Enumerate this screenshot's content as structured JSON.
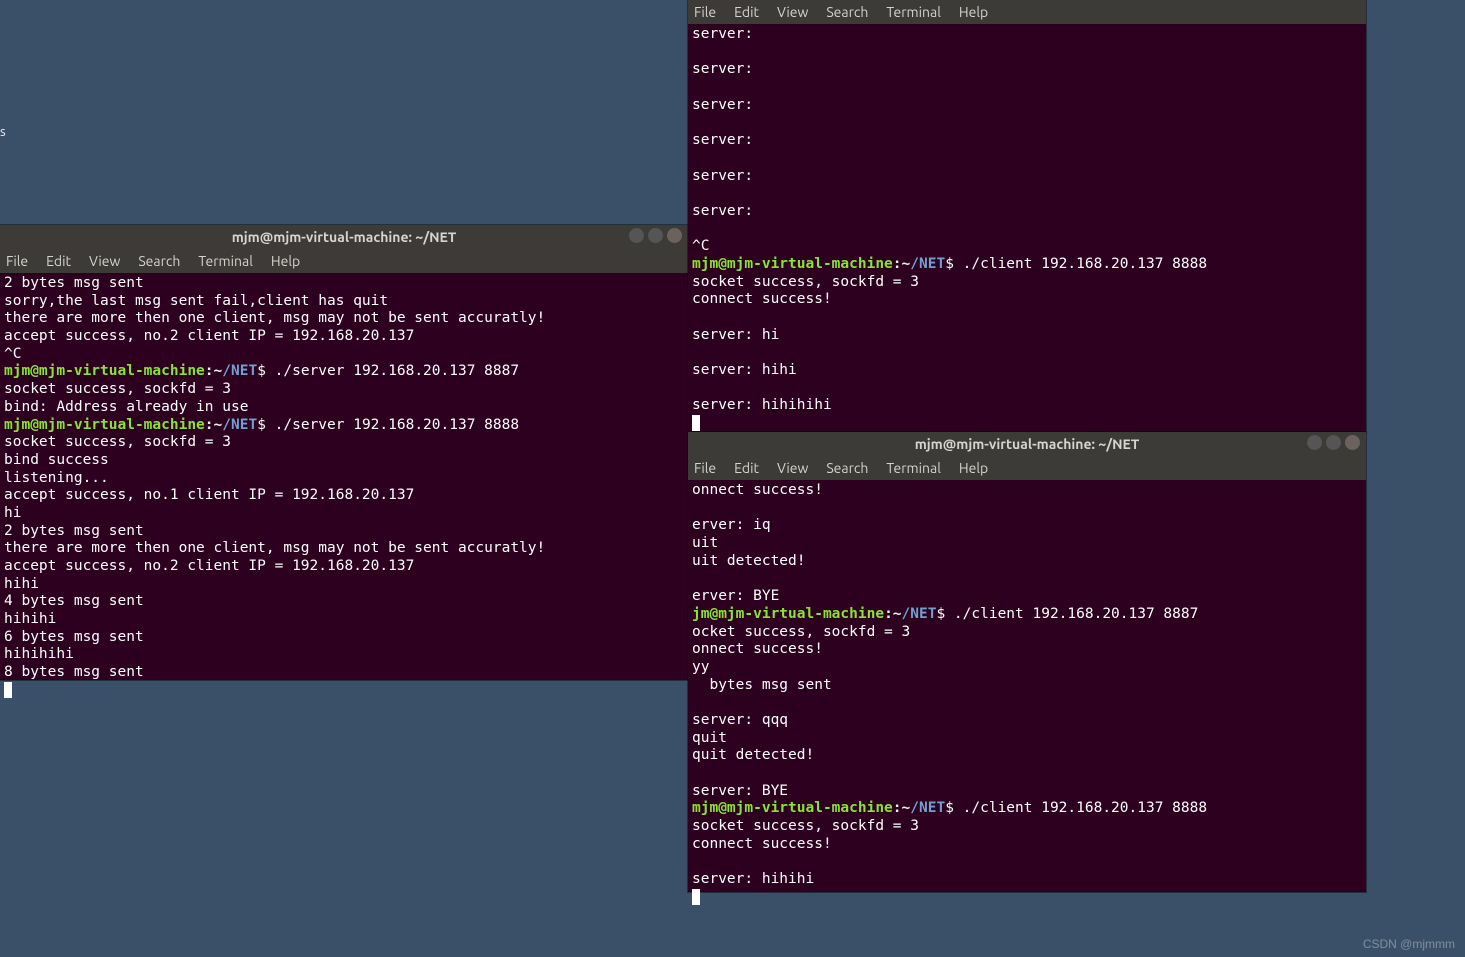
{
  "desktop_fragment": "s",
  "menus": {
    "file": "File",
    "edit": "Edit",
    "view": "View",
    "search": "Search",
    "terminal": "Terminal",
    "help": "Help"
  },
  "prompt": {
    "user_host": "mjm@mjm-virtual-machine",
    "colon": ":",
    "tilde": "~",
    "path": "/NET",
    "dollar": "$ "
  },
  "left": {
    "title": "mjm@mjm-virtual-machine: ~/NET",
    "pre_lines": [
      "2 bytes msg sent",
      "sorry,the last msg sent fail,client has quit",
      "there are more then one client, msg may not be sent accuratly!",
      "accept success, no.2 client IP = 192.168.20.137",
      "^C"
    ],
    "cmd1": "./server 192.168.20.137 8887",
    "mid1": [
      "socket success, sockfd = 3",
      "bind: Address already in use"
    ],
    "cmd2": "./server 192.168.20.137 8888",
    "mid2": [
      "socket success, sockfd = 3",
      "bind success",
      "listening...",
      "accept success, no.1 client IP = 192.168.20.137",
      "hi",
      "2 bytes msg sent",
      "there are more then one client, msg may not be sent accuratly!",
      "accept success, no.2 client IP = 192.168.20.137",
      "hihi",
      "4 bytes msg sent",
      "hihihi",
      "6 bytes msg sent",
      "hihihihi",
      "8 bytes msg sent"
    ]
  },
  "top_right": {
    "pre_lines": [
      "server: ",
      "",
      "server: ",
      "",
      "server: ",
      "",
      "server: ",
      "",
      "server: ",
      "",
      "server: ",
      "",
      "^C"
    ],
    "cmd": "./client 192.168.20.137 8888",
    "post": [
      "socket success, sockfd = 3",
      "connect success!",
      "",
      "server: hi",
      "",
      "server: hihi",
      "",
      "server: hihihihi"
    ]
  },
  "bottom_right": {
    "title": "mjm@mjm-virtual-machine: ~/NET",
    "pre_lines": [
      "onnect success!",
      "",
      "erver: iq",
      "uit",
      "uit detected!",
      "",
      "erver: BYE"
    ],
    "cmd1_user": "jm@mjm-virtual-machine",
    "cmd1": "./client 192.168.20.137 8887",
    "mid1": [
      "ocket success, sockfd = 3",
      "onnect success!",
      "yy",
      "  bytes msg sent",
      "",
      "server: qqq",
      "quit",
      "quit detected!",
      "",
      "server: BYE"
    ],
    "cmd2": "./client 192.168.20.137 8888",
    "mid2": [
      "socket success, sockfd = 3",
      "connect success!",
      "",
      "server: hihihi"
    ]
  },
  "watermark": "CSDN @mjmmm"
}
